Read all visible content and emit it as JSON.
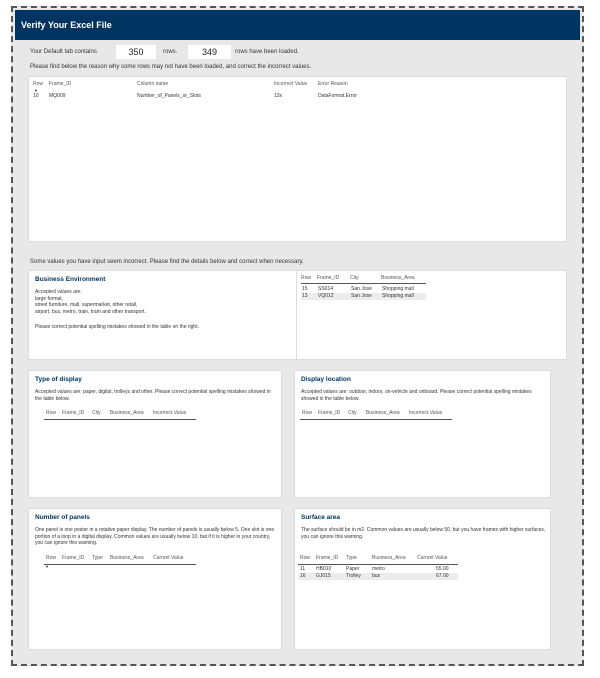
{
  "header": {
    "title": "Verify Your Excel File"
  },
  "summary": {
    "prefix": "Your Default tab contains",
    "total_rows": "350",
    "mid": "rows.",
    "loaded_rows": "349",
    "suffix": "rows have been loaded."
  },
  "instructions": {
    "missing": "Please find below the reason why some rows may not have been loaded, and correct the incorrect values.",
    "incorrect": "Some values you have input seem incorrect. Please find the details below and correct when necessary."
  },
  "errors_table": {
    "headers": [
      "Row",
      "Frame_ID",
      "Column name",
      "Incorrect Value",
      "Error Reason"
    ],
    "rows": [
      [
        "10",
        "MQ009",
        "Number_of_Panels_or_Slots",
        "13x",
        "DataFormat.Error"
      ]
    ]
  },
  "business": {
    "title": "Business Environment",
    "desc_lines": [
      "Accepted values are:",
      "large format,",
      "street furniture, mall, supermarket, other retail,",
      "airport, bus, metro, train, tram and other transport."
    ],
    "note": "Please correct potential spelling mistakes showed in the table on the right.",
    "headers": [
      "Row",
      "Frame_ID",
      "City",
      "Business_Area"
    ],
    "rows": [
      [
        "15",
        "SS014",
        "San Jose",
        "Shopping mall"
      ],
      [
        "13",
        "VQ012",
        "San Jose",
        "Shopping mall"
      ]
    ]
  },
  "type_display": {
    "title": "Type of display",
    "desc": "Accepted values are: paper, digital, trolleys and other. Please correct potential spelling mistakes showed in the table below.",
    "headers": [
      "Row",
      "Frame_ID",
      "City",
      "Business_Area",
      "Incorrect Value"
    ]
  },
  "display_location": {
    "title": "Display location",
    "desc": "Accepted values are: outdoor, indoor, on-vehicle and onboard. Please correct potential spelling mistakes showed in the table below.",
    "headers": [
      "Row",
      "Frame_ID",
      "City",
      "Business_Area",
      "Incorrect Value"
    ]
  },
  "panels": {
    "title": "Number of panels",
    "desc": "One panel is one poster in a rotative paper display. The number of panels is usually below 5. One slot is one portion of a loop in a digital display. Common values are usually below 10, but if it is higher in your country, you can ignore this warning.",
    "headers": [
      "Row",
      "Frame_ID",
      "Type",
      "Business_Area",
      "Current Value"
    ]
  },
  "surface": {
    "title": "Surface area",
    "desc": "The surface should be in m2. Common values are usually below 50, but you have frames with higher surfaces, you can ignore this warning.",
    "headers": [
      "Row",
      "Frame_ID",
      "Type",
      "Business_Area",
      "Current Value"
    ],
    "rows": [
      [
        "11",
        "HB010",
        "Paper",
        "metro",
        "55.00"
      ],
      [
        "16",
        "GJ015",
        "Trolley",
        "bus",
        "67.00"
      ]
    ]
  }
}
